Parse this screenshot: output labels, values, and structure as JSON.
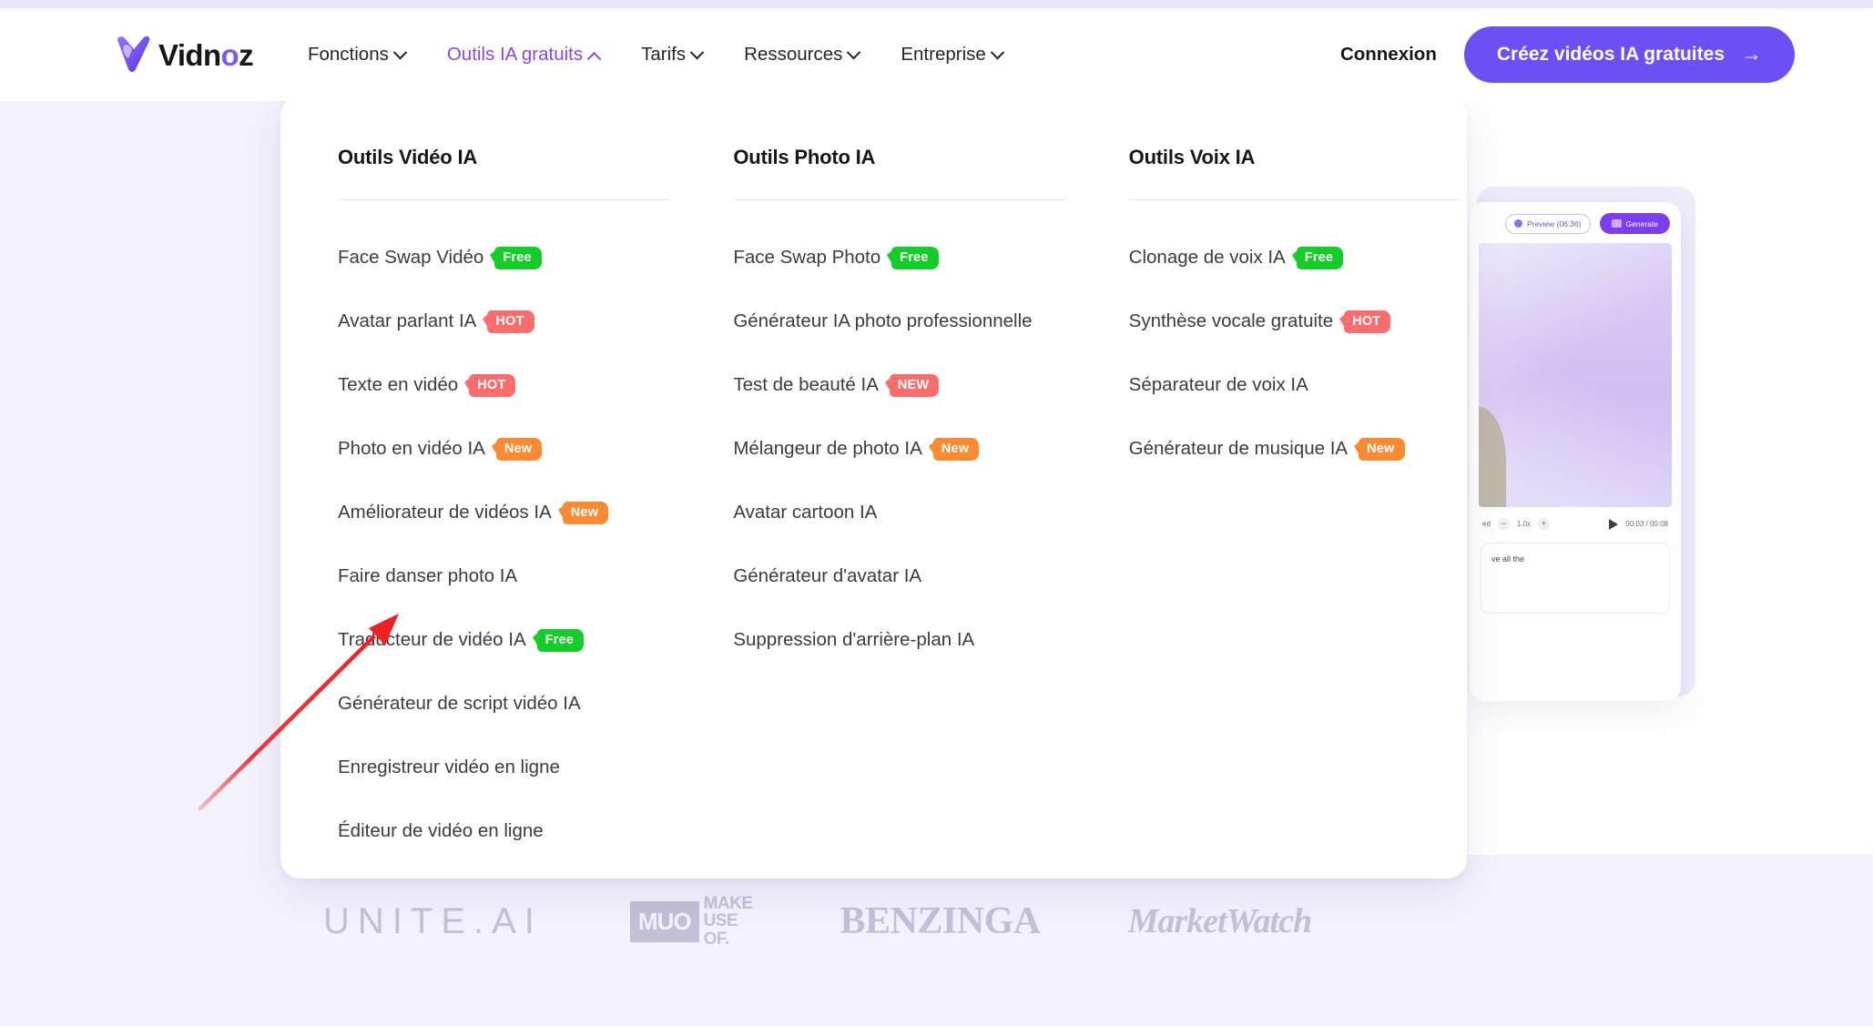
{
  "brand": {
    "name_prefix": "Vidn",
    "name_accent": "o",
    "name_suffix": "z",
    "logo_icon": "vidnoz-v-logo-icon",
    "accent_color": "#7b5bf2",
    "cta_color": "#6e4ff6"
  },
  "header": {
    "nav": [
      {
        "label": "Fonctions",
        "chevron": "chevron-down-icon",
        "active": false
      },
      {
        "label": "Outils IA gratuits",
        "chevron": "chevron-up-icon",
        "active": true
      },
      {
        "label": "Tarifs",
        "chevron": "chevron-down-icon",
        "active": false
      },
      {
        "label": "Ressources",
        "chevron": "chevron-down-icon",
        "active": false
      },
      {
        "label": "Entreprise",
        "chevron": "chevron-down-icon",
        "active": false
      }
    ],
    "login_label": "Connexion",
    "cta_label": "Créez vidéos IA gratuites",
    "cta_arrow": "→"
  },
  "dropdown": {
    "columns": [
      {
        "title": "Outils Vidéo IA",
        "items": [
          {
            "label": "Face Swap Vidéo",
            "badge": "Free",
            "badge_type": "free"
          },
          {
            "label": "Avatar parlant IA",
            "badge": "HOT",
            "badge_type": "hot"
          },
          {
            "label": "Texte en vidéo",
            "badge": "HOT",
            "badge_type": "hot"
          },
          {
            "label": "Photo en vidéo IA",
            "badge": "New",
            "badge_type": "new"
          },
          {
            "label": "Améliorateur de vidéos IA",
            "badge": "New",
            "badge_type": "new"
          },
          {
            "label": "Faire danser photo IA",
            "badge": null,
            "badge_type": null
          },
          {
            "label": "Traducteur de vidéo IA",
            "badge": "Free",
            "badge_type": "free"
          },
          {
            "label": "Générateur de script vidéo IA",
            "badge": null,
            "badge_type": null
          },
          {
            "label": "Enregistreur vidéo en ligne",
            "badge": null,
            "badge_type": null
          },
          {
            "label": "Éditeur de vidéo en ligne",
            "badge": null,
            "badge_type": null
          }
        ]
      },
      {
        "title": "Outils Photo IA",
        "items": [
          {
            "label": "Face Swap Photo",
            "badge": "Free",
            "badge_type": "free"
          },
          {
            "label": "Générateur IA photo professionnelle",
            "badge": null,
            "badge_type": null
          },
          {
            "label": "Test de beauté IA",
            "badge": "NEW",
            "badge_type": "newr"
          },
          {
            "label": "Mélangeur de photo IA",
            "badge": "New",
            "badge_type": "new"
          },
          {
            "label": "Avatar cartoon IA",
            "badge": null,
            "badge_type": null
          },
          {
            "label": "Générateur d'avatar IA",
            "badge": null,
            "badge_type": null
          },
          {
            "label": "Suppression d'arrière-plan IA",
            "badge": null,
            "badge_type": null
          }
        ]
      },
      {
        "title": "Outils Voix IA",
        "items": [
          {
            "label": "Clonage de voix IA",
            "badge": "Free",
            "badge_type": "free"
          },
          {
            "label": "Synthèse vocale gratuite",
            "badge": "HOT",
            "badge_type": "hot"
          },
          {
            "label": "Séparateur de voix IA",
            "badge": null,
            "badge_type": null
          },
          {
            "label": "Générateur de musique IA",
            "badge": "New",
            "badge_type": "new"
          }
        ]
      }
    ]
  },
  "preview_card": {
    "preview_button": "Preview (06:36)",
    "generate_button": "Generate",
    "speed": "1.0x",
    "speed_minus": "−",
    "speed_plus": "+",
    "time": "00:03 / 00:08",
    "left_control": "ed",
    "script_text": "ve all the"
  },
  "press": {
    "logos": [
      {
        "name": "UNITE.AI",
        "text": "UNITE.AI"
      },
      {
        "name": "MakeUseOf",
        "badge": "MUO",
        "line1": "MAKE",
        "line2": "USE",
        "line3": "OF."
      },
      {
        "name": "BENZINGA",
        "text": "BENZINGA"
      },
      {
        "name": "MarketWatch",
        "text": "MarketWatch"
      }
    ]
  },
  "annotation": {
    "type": "red-arrow",
    "color": "#ef2222",
    "points_to": "Traducteur de vidéo IA"
  },
  "colors": {
    "badge_free": "#15cd28",
    "badge_hot": "#fb6d6d",
    "badge_new": "#fa8b32",
    "page_background": "#f4f2fd",
    "top_strip": "#e8e4fb"
  }
}
